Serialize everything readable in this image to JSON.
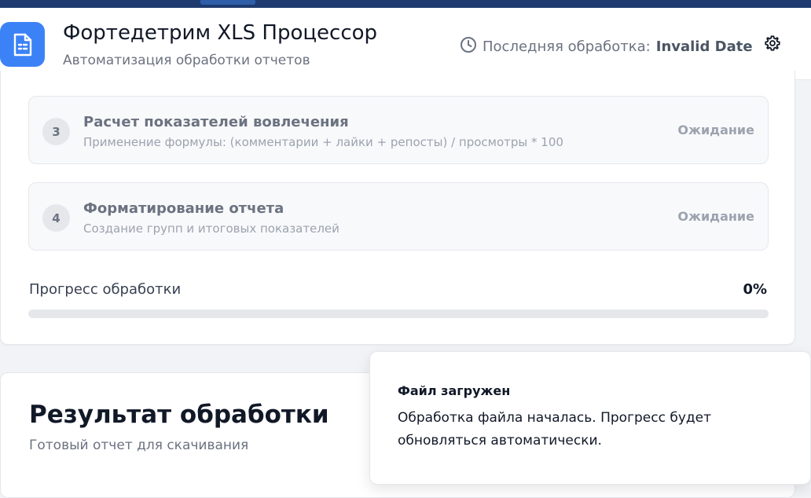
{
  "header": {
    "title": "Фортедетрим XLS Процессор",
    "subtitle": "Автоматизация обработки отчетов",
    "last_processing_label": "Последняя обработка:",
    "last_processing_value": "Invalid Date",
    "icons": {
      "logo": "document-icon",
      "clock": "clock-icon",
      "settings": "gear-icon"
    },
    "colors": {
      "accent": "#3b82f6",
      "topbar": "#1e3a6e"
    }
  },
  "steps": [
    {
      "number": "3",
      "title": "Расчет показателей вовлечения",
      "description": "Применение формулы: (комментарии + лайки + репосты) / просмотры * 100",
      "status": "Ожидание"
    },
    {
      "number": "4",
      "title": "Форматирование отчета",
      "description": "Создание групп и итоговых показателей",
      "status": "Ожидание"
    }
  ],
  "progress": {
    "label": "Прогресс обработки",
    "percent_text": "0%",
    "value": 0
  },
  "result": {
    "title": "Результат обработки",
    "subtitle": "Готовый отчет для скачивания"
  },
  "toast": {
    "title": "Файл загружен",
    "body": "Обработка файла началась. Прогресс будет обновляться автоматически."
  }
}
